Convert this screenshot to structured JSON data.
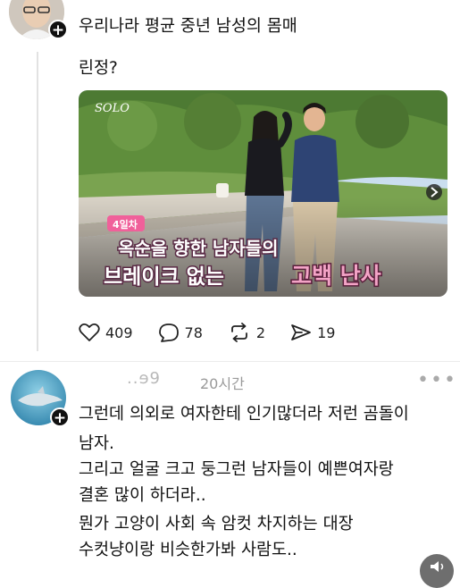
{
  "post": {
    "avatar_icon": "profile-photo",
    "text_line1": "우리나라 평균 중년 남성의 몸매",
    "text_line2": "린정?",
    "media": {
      "logo": "SOLO",
      "badge": "4일차",
      "caption_line1": "옥순을 향한 남자들의",
      "caption_line2a": "브레이크 없는",
      "caption_line2b": "고백 난사",
      "arrow_icon": "next-arrow-icon"
    },
    "likes": "409",
    "comments": "78",
    "reposts": "2",
    "shares": "19"
  },
  "reply": {
    "username": "..ɘ9",
    "time": "20시간",
    "more": "•••",
    "lines": [
      "그런데 의외로 여자한테 인기많더라 저런 곰돌이",
      "남자.",
      "그리고 얼굴 크고 둥그런 남자들이 예쁜여자랑",
      "결혼 많이 하더라..",
      "뭔가 고양이 사회 속 암컷 차지하는 대장",
      "수컷냥이랑 비슷한가봐 사람도.."
    ]
  },
  "colors": {
    "caption_pink": "#e8407a",
    "badge_pink": "#f0609a",
    "text": "#111111"
  }
}
